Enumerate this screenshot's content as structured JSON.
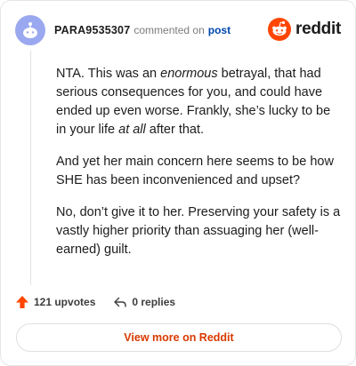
{
  "comment": {
    "username": "PARA9535307",
    "commented_on": "commented on",
    "post_link": "post",
    "paragraphs": [
      [
        {
          "text": "NTA. This was an ",
          "em": false
        },
        {
          "text": "enormous",
          "em": true
        },
        {
          "text": " betrayal, that had serious consequences for you, and could have ended up even worse. Frankly, she’s lucky to be in your life ",
          "em": false
        },
        {
          "text": "at all",
          "em": true
        },
        {
          "text": " after that.",
          "em": false
        }
      ],
      [
        {
          "text": "And yet her main concern here seems to be how SHE has been inconvenienced and upset?",
          "em": false
        }
      ],
      [
        {
          "text": "No, don’t give it to her. Preserving your safety is a vastly higher priority than assuaging her (well-earned) guilt.",
          "em": false
        }
      ]
    ]
  },
  "brand": {
    "wordmark": "reddit",
    "icon": "reddit-snoo-icon",
    "color": "#ff4500"
  },
  "footer": {
    "upvotes": "121 upvotes",
    "replies": "0 replies",
    "upvote_icon": "upvote-arrow-icon",
    "reply_icon": "reply-arrow-icon",
    "upvote_color": "#ff4500"
  },
  "cta": {
    "label": "View more on Reddit",
    "color": "#d93a00"
  }
}
